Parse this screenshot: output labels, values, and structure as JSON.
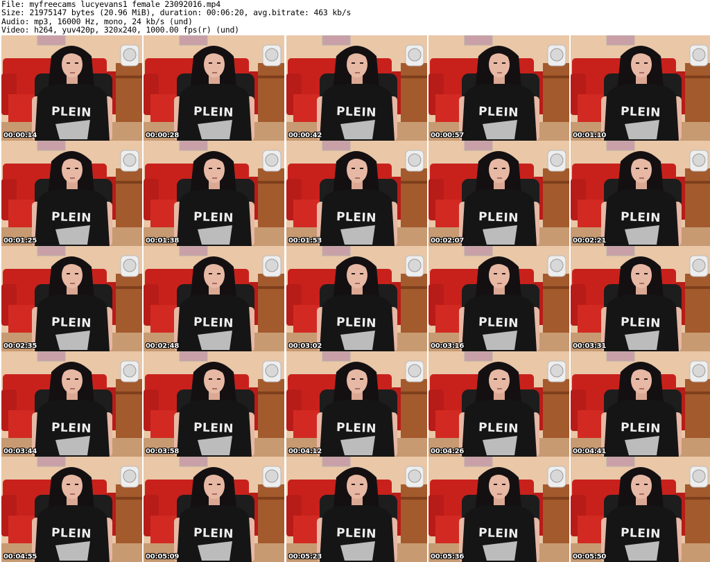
{
  "header": {
    "file": "File: myfreecams_lucyevans1_female_23092016.mp4",
    "size": "Size: 21975147 bytes (20.96 MiB), duration: 00:06:20, avg.bitrate: 463 kb/s",
    "audio": "Audio: mp3, 16000 Hz, mono, 24 kb/s (und)",
    "video": "Video: h264, yuv420p, 320x240, 1000.00 fps(r) (und)"
  },
  "shirt_text": "PLEIN",
  "colors": {
    "wall": "#e9c7a7",
    "couch": "#c8211c",
    "hair": "#141012",
    "skin": "#e7b8a4",
    "shirt": "#151515",
    "fan": "#eeeeee",
    "shelf": "#a35a2c",
    "picture": "#c9a0a8"
  },
  "thumbnails": [
    {
      "timestamp": "00:00:14"
    },
    {
      "timestamp": "00:00:28"
    },
    {
      "timestamp": "00:00:42"
    },
    {
      "timestamp": "00:00:57"
    },
    {
      "timestamp": "00:01:10"
    },
    {
      "timestamp": "00:01:25"
    },
    {
      "timestamp": "00:01:38"
    },
    {
      "timestamp": "00:01:53"
    },
    {
      "timestamp": "00:02:07"
    },
    {
      "timestamp": "00:02:21"
    },
    {
      "timestamp": "00:02:35"
    },
    {
      "timestamp": "00:02:48"
    },
    {
      "timestamp": "00:03:02"
    },
    {
      "timestamp": "00:03:16"
    },
    {
      "timestamp": "00:03:31"
    },
    {
      "timestamp": "00:03:44"
    },
    {
      "timestamp": "00:03:58"
    },
    {
      "timestamp": "00:04:12"
    },
    {
      "timestamp": "00:04:26"
    },
    {
      "timestamp": "00:04:41"
    },
    {
      "timestamp": "00:04:55"
    },
    {
      "timestamp": "00:05:09"
    },
    {
      "timestamp": "00:05:23"
    },
    {
      "timestamp": "00:05:36"
    },
    {
      "timestamp": "00:05:50"
    }
  ]
}
